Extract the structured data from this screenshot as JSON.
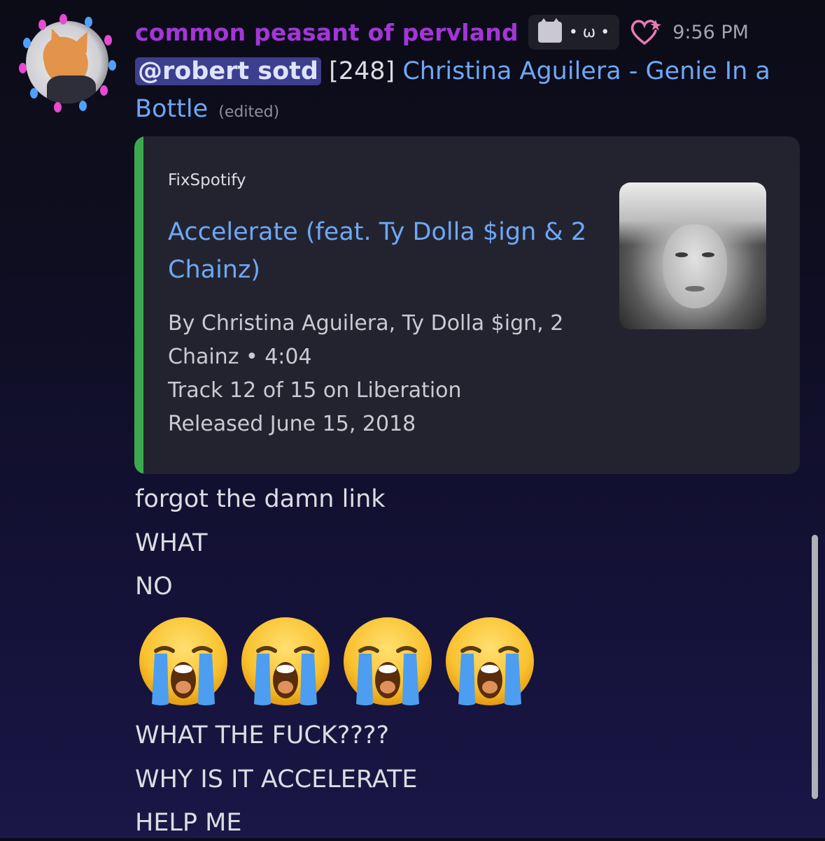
{
  "message": {
    "username": "common peasant of pervland",
    "tag_text": "• ω •",
    "timestamp": "9:56 PM",
    "mention": "@robert sotd",
    "number_prefix": "[248]",
    "link_text_line1": "Christina Aguilera - Genie In a",
    "link_text_line2": "Bottle",
    "edited_label": "(edited)"
  },
  "embed": {
    "provider": "FixSpotify",
    "title": "Accelerate (feat. Ty Dolla $ign & 2 Chainz)",
    "description_lines": [
      "By Christina Aguilera, Ty Dolla $ign, 2",
      "Chainz • 4:04",
      "Track 12 of 15 on Liberation",
      "Released June 15, 2018"
    ],
    "accent_color": "#3ca94f"
  },
  "followups": [
    "forgot the damn link",
    "WHAT",
    "NO"
  ],
  "emoji": [
    "loudly-crying-face",
    "loudly-crying-face",
    "loudly-crying-face",
    "loudly-crying-face"
  ],
  "followups_after": [
    "WHAT THE FUCK????",
    "WHY IS IT ACCELERATE",
    "HELP ME"
  ],
  "colors": {
    "username": "#a336d8",
    "link": "#6ea8f5",
    "mention_bg": "#3b3f8e"
  },
  "icons": {
    "tag_icon": "pixel-cat-icon",
    "badge_icon": "heart-sparkle-icon"
  }
}
